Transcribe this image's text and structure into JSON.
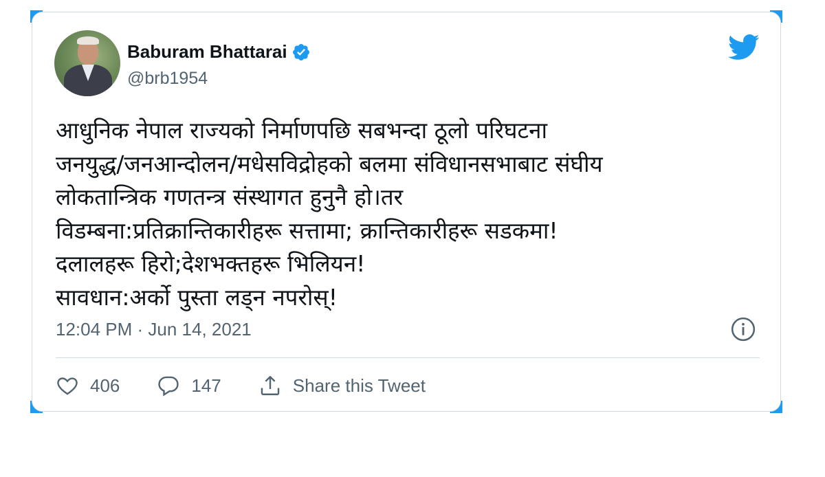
{
  "author": {
    "display_name": "Baburam Bhattarai",
    "handle": "@brb1954",
    "verified": true
  },
  "tweet": {
    "lines": [
      "आधुनिक नेपाल राज्यको निर्माणपछि सबभन्दा ठूलो परिघटना",
      "जनयुद्ध/जनआन्दोलन/मधेसविद्रोहको बलमा संविधानसभाबाट संघीय",
      "लोकतान्त्रिक गणतन्त्र संस्थागत हुनुनै हो।तर",
      "विडम्बना:प्रतिक्रान्तिकारीहरू सत्तामा; क्रान्तिकारीहरू सडकमा!",
      "दलालहरू हिरो;देशभक्तहरू भिलियन!",
      "सावधान:अर्को पुस्ता लड्न नपरोस्!"
    ],
    "timestamp": "12:04 PM · Jun 14, 2021"
  },
  "actions": {
    "likes": "406",
    "replies": "147",
    "share_label": "Share this Tweet"
  },
  "icons": {
    "brand": "twitter-bird-icon",
    "verified": "verified-badge-icon",
    "info": "info-icon",
    "like": "heart-icon",
    "reply": "reply-bubble-icon",
    "share": "share-icon"
  },
  "colors": {
    "brand": "#1d9bf0",
    "text": "#0f1419",
    "secondary": "#536471",
    "border": "#cfd9de"
  }
}
